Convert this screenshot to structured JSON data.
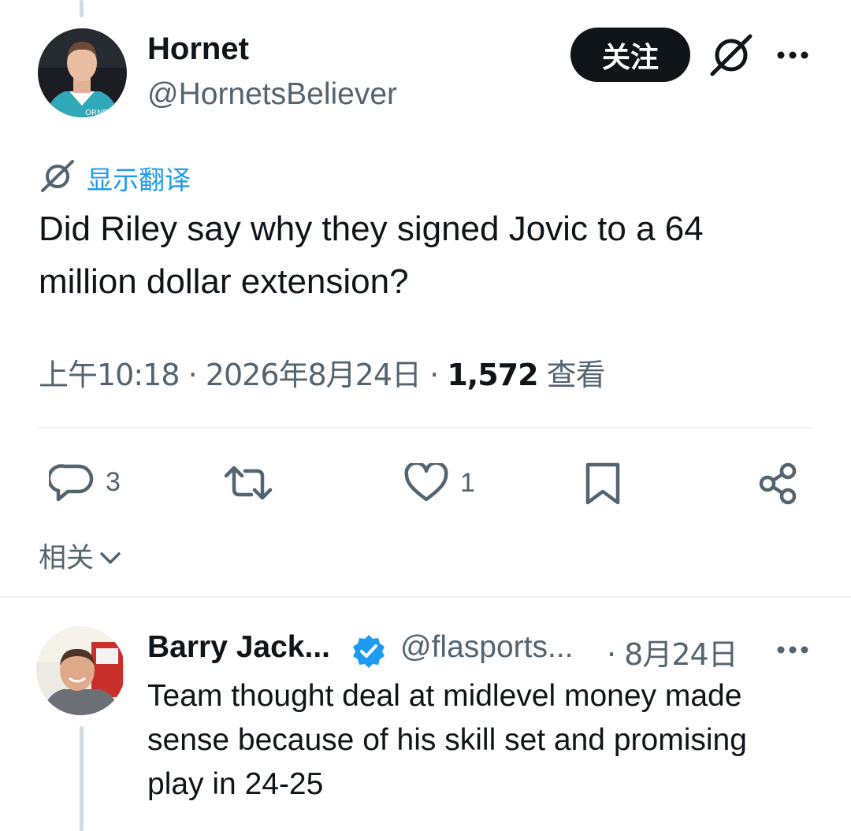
{
  "tweet": {
    "author": {
      "display_name": "Hornet",
      "handle": "@HornetsBeliever",
      "follow_label": "关注"
    },
    "translate_label": "显示翻译",
    "body_line1": "Did Riley say why they signed Jovic to a 64",
    "body_line2": "million dollar extension?",
    "meta": {
      "time": "上午10:18",
      "sep1": "·",
      "date": "2026年8月24日",
      "sep2": "·",
      "views_count": "1,572",
      "views_label": "查看"
    },
    "actions": {
      "replies": "3",
      "likes": "1"
    }
  },
  "related_label": "相关",
  "reply": {
    "display_name": "Barry Jack...",
    "handle": "@flasports...",
    "date": "· 8月24日",
    "text_line1": "Team thought deal at midlevel money made",
    "text_line2": "sense because of his skill set and promising",
    "text_line3": "play in 24-25",
    "verified_color": "#1d9bf0"
  },
  "colors": {
    "text": "#0f1419",
    "muted": "#536471",
    "link": "#1d9bf0",
    "button": "#0f1419"
  }
}
